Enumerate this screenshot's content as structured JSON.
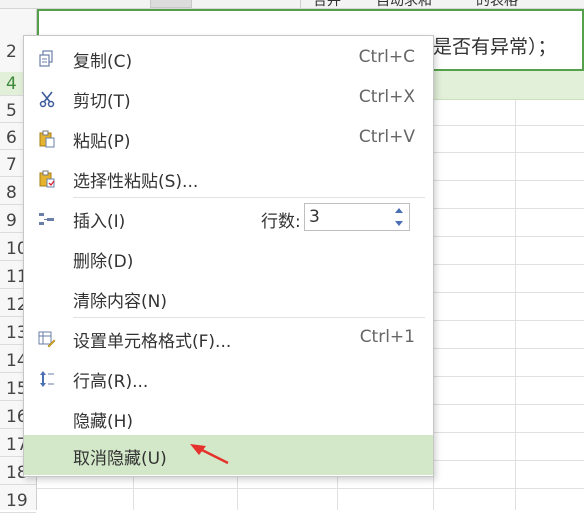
{
  "toolbar": {
    "btn1_label": "合并",
    "btn2_label": "自动求和",
    "btn3_label": "的表格"
  },
  "row_headers": [
    "2",
    "4",
    "5",
    "6",
    "7",
    "8",
    "9",
    "10",
    "11",
    "12",
    "13",
    "14",
    "15",
    "16",
    "17",
    "18",
    "19"
  ],
  "active_row": "4",
  "cell_text": "是否有异常）；",
  "context_menu": {
    "items": [
      {
        "label": "复制(C)",
        "shortcut": "Ctrl+C",
        "icon": "copy-icon"
      },
      {
        "label": "剪切(T)",
        "shortcut": "Ctrl+X",
        "icon": "scissors-icon"
      },
      {
        "label": "粘贴(P)",
        "shortcut": "Ctrl+V",
        "icon": "paste-icon"
      },
      {
        "label": "选择性粘贴(S)...",
        "shortcut": "",
        "icon": "paste-special-icon"
      },
      {
        "label": "插入(I)",
        "shortcut": "",
        "icon": "insert-row-icon"
      },
      {
        "label": "删除(D)",
        "shortcut": "",
        "icon": ""
      },
      {
        "label": "清除内容(N)",
        "shortcut": "",
        "icon": ""
      },
      {
        "label": "设置单元格格式(F)...",
        "shortcut": "Ctrl+1",
        "icon": "format-cells-icon"
      },
      {
        "label": "行高(R)...",
        "shortcut": "",
        "icon": "row-height-icon"
      },
      {
        "label": "隐藏(H)",
        "shortcut": "",
        "icon": ""
      },
      {
        "label": "取消隐藏(U)",
        "shortcut": "",
        "icon": ""
      }
    ],
    "rows_label": "行数:",
    "rows_value": "3",
    "highlighted_item": "取消隐藏(U)"
  },
  "colors": {
    "accent_green": "#55a04a",
    "highlight_green": "#d3e8c9",
    "arrow_red": "#e5322d"
  }
}
